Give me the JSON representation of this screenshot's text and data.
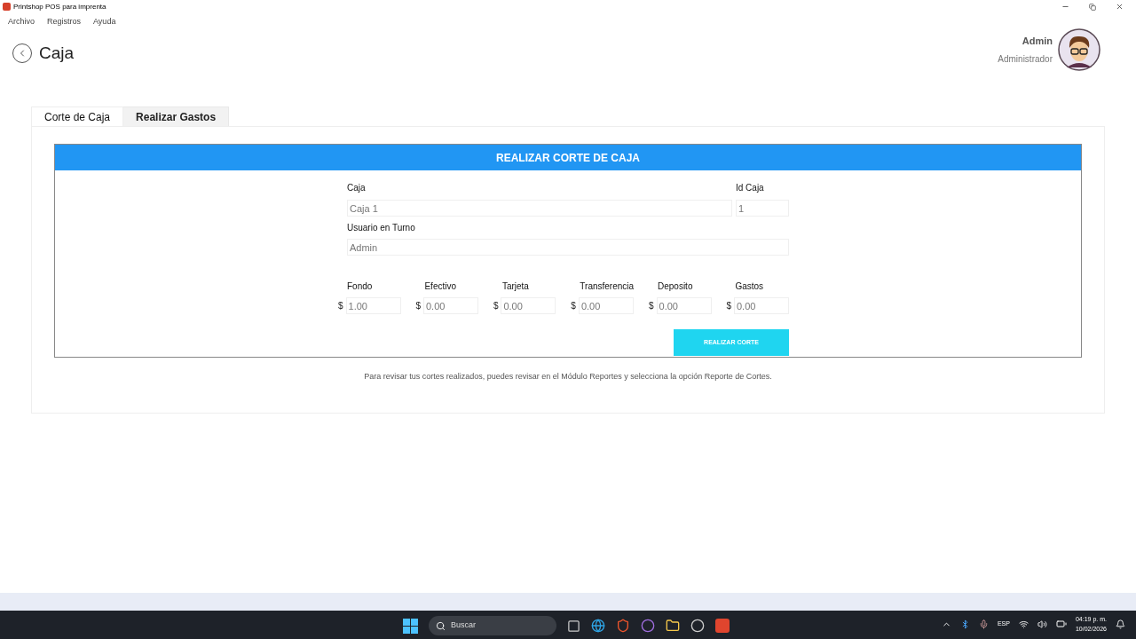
{
  "window": {
    "title": "Printshop POS para imprenta"
  },
  "menu": [
    "Archivo",
    "Registros",
    "Ayuda"
  ],
  "page": {
    "title": "Caja"
  },
  "user": {
    "name": "Admin",
    "role": "Administrador"
  },
  "tabs": [
    {
      "label": "Corte de Caja",
      "selected": true
    },
    {
      "label": "Realizar Gastos",
      "selected": false
    }
  ],
  "form": {
    "header": "REALIZAR CORTE DE CAJA",
    "caja": {
      "label": "Caja",
      "value": "Caja 1"
    },
    "id_caja": {
      "label": "Id Caja",
      "value": "1"
    },
    "usuario": {
      "label": "Usuario en Turno",
      "value": "Admin"
    },
    "amounts": [
      {
        "label": "Fondo",
        "currency": "$",
        "value": "1.00"
      },
      {
        "label": "Efectivo",
        "currency": "$",
        "value": "0.00"
      },
      {
        "label": "Tarjeta",
        "currency": "$",
        "value": "0.00"
      },
      {
        "label": "Transferencia",
        "currency": "$",
        "value": "0.00"
      },
      {
        "label": "Deposito",
        "currency": "$",
        "value": "0.00"
      },
      {
        "label": "Gastos",
        "currency": "$",
        "value": "0.00"
      }
    ],
    "button": "REALIZAR CORTE"
  },
  "note": "Para revisar tus cortes realizados, puedes revisar en el Módulo Reportes y selecciona la opción Reporte de Cortes.",
  "taskbar": {
    "search_placeholder": "Buscar",
    "language": "ESP",
    "time": "04:19 p. m.",
    "date": "10/02/2026"
  }
}
